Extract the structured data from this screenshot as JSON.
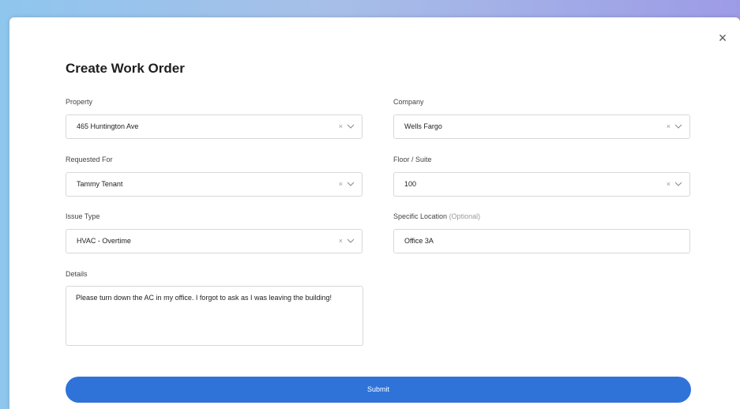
{
  "dialog": {
    "title": "Create Work Order",
    "close_glyph": "×"
  },
  "form": {
    "property": {
      "label": "Property",
      "value": "465 Huntington Ave"
    },
    "company": {
      "label": "Company",
      "value": "Wells Fargo"
    },
    "requested_for": {
      "label": "Requested For",
      "value": "Tammy Tenant"
    },
    "floor_suite": {
      "label": "Floor / Suite",
      "value": "100"
    },
    "issue_type": {
      "label": "Issue Type",
      "value": "HVAC - Overtime"
    },
    "specific_location": {
      "label": "Specific Location",
      "optional": "(Optional)",
      "value": "Office 3A"
    },
    "details": {
      "label": "Details",
      "value": "Please turn down the AC in my office. I forgot to ask as I was leaving the building!"
    },
    "clear_glyph": "×",
    "icons": {
      "clear": "clear-icon",
      "chevron": "chevron-down-icon",
      "close": "close-icon"
    }
  },
  "submit_label": "Submit",
  "colors": {
    "primary": "#2f73d9",
    "backdrop_left": "#8fc6ee",
    "backdrop_right": "#9d9be6"
  }
}
